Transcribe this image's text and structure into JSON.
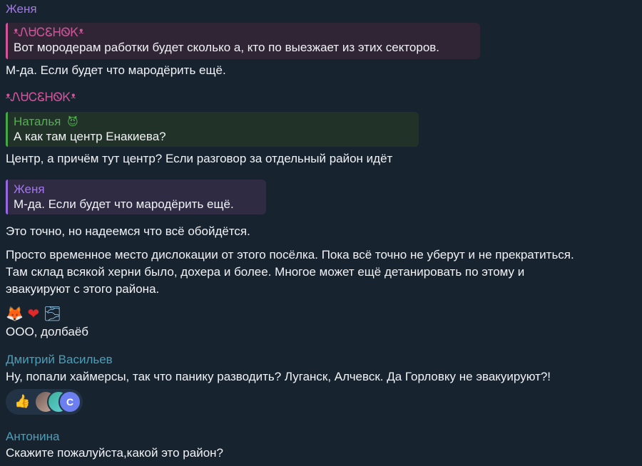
{
  "colors": {
    "background": "#182330",
    "purple": "#a478e8",
    "pink": "#d0559b",
    "green": "#52b050",
    "teal": "#4b9fb8"
  },
  "messages": [
    {
      "sender": "Женя",
      "quote": {
        "sender": "ᵜᏁᏌᏟᏋᎻᏫᏦᵜ",
        "text": "Вот мородерам работки будет сколько а, кто по выезжает из этих секторов."
      },
      "text": "М-да. Если будет что мародёрить ещё."
    },
    {
      "sender": "ᵜᏁᏌᏟᏋᎻᏫᏦᵜ",
      "quote": {
        "sender": "Наталья",
        "sender_emoji": "😈",
        "text": "А как там центр Енакиева?"
      },
      "text": "Центр, а причём тут центр? Если разговор за отдельный район идёт"
    },
    {
      "quote": {
        "sender": "Женя",
        "text": "М-да. Если будет что мародёрить ещё."
      },
      "text": "Это точно, но надеемся что всё обойдётся."
    },
    {
      "lines": [
        "Просто временное место дислокации от этого посёлка. Пока всё точно не уберут и не прекратиться.",
        "Там склад всякой херни было, дохера и более. Многое может ещё детанировать по этому и",
        "эвакуируют с этого района."
      ]
    },
    {
      "emojis": [
        "🦊",
        "❤",
        "🌫"
      ],
      "text": "ООО, долбаёб"
    },
    {
      "sender": "Дмитрий Васильев",
      "text": "Ну, попали хаймерсы, так что панику разводить? Луганск, Алчевск. Да Горловку не эвакуируют?!",
      "reaction": {
        "emoji": "👍",
        "avatar_letter": "C"
      }
    },
    {
      "sender": "Антонина",
      "text": "Скажите пожалуйста,какой это район?"
    }
  ]
}
